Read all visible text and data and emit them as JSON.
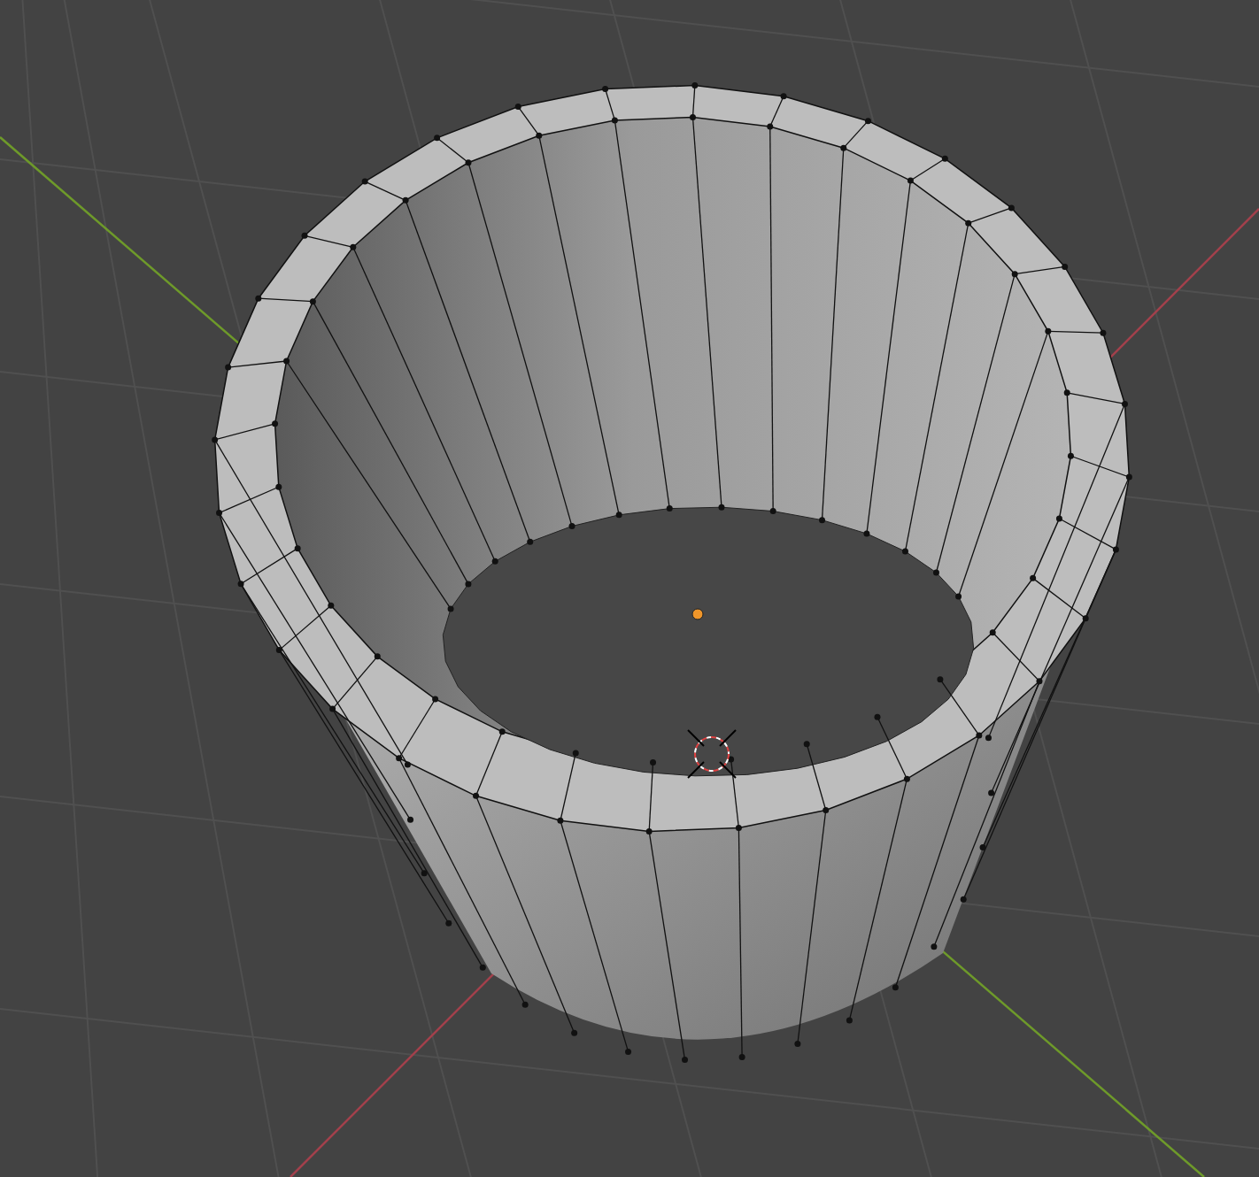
{
  "viewport": {
    "items": [
      {
        "kind": "grid"
      },
      {
        "kind": "axis-x"
      },
      {
        "kind": "axis-y"
      },
      {
        "kind": "mesh"
      },
      {
        "kind": "origin"
      },
      {
        "kind": "cursor"
      }
    ]
  }
}
